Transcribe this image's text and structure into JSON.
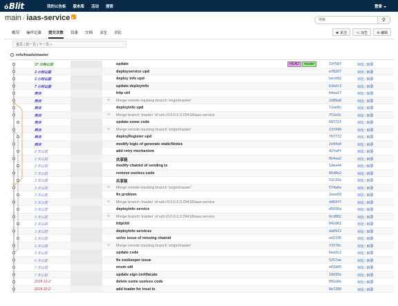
{
  "header": {
    "brand": "Blit",
    "brand_prefix": "ó",
    "nav": [
      "我的公告板",
      "版本库",
      "活动",
      "搜索"
    ],
    "active_nav": 1,
    "login": "登录"
  },
  "repo": {
    "owner": "main",
    "separator": " / ",
    "name": "iaas-service",
    "rss_icon": "rss-icon"
  },
  "search": {
    "placeholder": "搜索",
    "icon": "search-icon"
  },
  "subnav": {
    "items": [
      "概况",
      "操作记录",
      "提交次数",
      "目录",
      "文档",
      "派生",
      "对比"
    ],
    "active": 2
  },
  "actions": {
    "watch": "★ 关注",
    "fork": "⌥ 派生",
    "edit": "⚙ 编辑"
  },
  "pager": "首页 | 前一页 | 下一页 »",
  "ref": "refs/heads/master",
  "badges": {
    "head": "HEAD",
    "master": "master"
  },
  "link_compare": "对比",
  "link_tree": "目录",
  "link_sep": "|",
  "colors": {
    "topbar": "#0a2a4a",
    "merge": "#48a845",
    "link": "#2a5fa8",
    "head_badge": "#f19bf4",
    "master_badge": "#9ef58a"
  },
  "commits": [
    {
      "date": "37 分钟以前",
      "msg": "update",
      "hash": "19f587",
      "merge": false,
      "dc": "c-green",
      "bold": true
    },
    {
      "date": "3 小时以前",
      "msg": "deployservice upd",
      "hash": "ef8267",
      "merge": false,
      "dc": "c-blue",
      "bold": true
    },
    {
      "date": "3 小时以前",
      "msg": "deploy info upd",
      "hash": "becb02",
      "merge": false,
      "dc": "c-blue",
      "bold": true
    },
    {
      "date": "7 小时以前",
      "msg": "update deployinfo",
      "hash": "b1bdc3",
      "merge": false,
      "dc": "c-blue",
      "bold": true
    },
    {
      "date": "昨天",
      "msg": "http util",
      "hash": "b4aa17",
      "merge": false,
      "dc": "c-blue",
      "bold": true
    },
    {
      "date": "昨天",
      "msg": "Merge remote-tracking branch 'origin/master'",
      "hash": "2d89a8",
      "merge": true,
      "dc": "c-blue",
      "bold": true
    },
    {
      "date": "昨天",
      "msg": "deployinfo upd",
      "hash": "f2ae9c",
      "merge": false,
      "dc": "c-blue",
      "bold": true
    },
    {
      "date": "昨天",
      "msg": "Merge branch 'master' of ssh://10.0.0.3:29418/iaas-service",
      "hash": "f51e3c",
      "merge": true,
      "dc": "c-blue",
      "bold": true
    },
    {
      "date": "昨天",
      "msg": "update some code",
      "hash": "68372f",
      "merge": false,
      "dc": "c-blue",
      "bold": true
    },
    {
      "date": "昨天",
      "msg": "Merge remote-tracking branch 'origin/master'",
      "hash": "23f499",
      "merge": true,
      "dc": "c-blue",
      "bold": true
    },
    {
      "date": "昨天",
      "msg": "deployRegister upd",
      "hash": "f6f772",
      "merge": false,
      "dc": "c-blue",
      "bold": true
    },
    {
      "date": "昨天",
      "msg": "modify logic of generate staticNodes",
      "hash": "2e94a4",
      "merge": false,
      "dc": "c-blue",
      "bold": true
    },
    {
      "date": "2 天以前",
      "msg": "add retry mechanism",
      "hash": "42fa0f",
      "merge": false,
      "dc": "c-lblue",
      "bold": false
    },
    {
      "date": "2 天以前",
      "msg": "共享链",
      "hash": "0b4aa2",
      "merge": false,
      "dc": "c-lblue",
      "bold": false
    },
    {
      "date": "2 天以前",
      "msg": "modify chainid of sending tx",
      "hash": "1dea44",
      "merge": false,
      "dc": "c-lblue",
      "bold": false
    },
    {
      "date": "3 天以前",
      "msg": "remove useless code",
      "hash": "66d8e2",
      "merge": false,
      "dc": "c-lblue",
      "bold": false
    },
    {
      "date": "3 天以前",
      "msg": "共享链",
      "hash": "52c32e",
      "merge": false,
      "dc": "c-lblue",
      "bold": false
    },
    {
      "date": "3 天以前",
      "msg": "Merge remote-tracking branch 'origin/master'",
      "hash": "574a6e",
      "merge": true,
      "dc": "c-lblue",
      "bold": false
    },
    {
      "date": "3 天以前",
      "msg": "fix problem",
      "hash": "2eee03",
      "merge": false,
      "dc": "c-lblue",
      "bold": false
    },
    {
      "date": "3 天以前",
      "msg": "Merge branch 'master' of ssh://10.0.0.3:29418/iaas-service",
      "hash": "d464ff",
      "merge": true,
      "dc": "c-lblue",
      "bold": false
    },
    {
      "date": "3 天以前",
      "msg": "deployinfo service",
      "hash": "d5030a",
      "merge": false,
      "dc": "c-lblue",
      "bold": false
    },
    {
      "date": "3 天以前",
      "msg": "Merge branch 'master' of ssh://10.0.0.3:29418/iaas-service",
      "hash": "0cd082",
      "merge": true,
      "dc": "c-lblue",
      "bold": false
    },
    {
      "date": "3 天以前",
      "msg": "httpUtil",
      "hash": "042d61",
      "merge": false,
      "dc": "c-lblue",
      "bold": false
    },
    {
      "date": "3 天以前",
      "msg": "deployinfo services",
      "hash": "da0913",
      "merge": false,
      "dc": "c-lblue",
      "bold": false
    },
    {
      "date": "3 天以前",
      "msg": "solve issue of missing chainid",
      "hash": "ed1195",
      "merge": false,
      "dc": "c-lblue",
      "bold": false
    },
    {
      "date": "3 天以前",
      "msg": "Merge remote-tracking branch 'origin/master'",
      "hash": "f3f70c",
      "merge": true,
      "dc": "c-lblue",
      "bold": false
    },
    {
      "date": "3 天以前",
      "msg": "update code",
      "hash": "bea3c2",
      "merge": false,
      "dc": "c-lblue",
      "bold": false
    },
    {
      "date": "6 天以前",
      "msg": "fix zookeeper issue",
      "hash": "5257ae",
      "merge": false,
      "dc": "c-lblue",
      "bold": false
    },
    {
      "date": "7 天以前",
      "msg": "enum util",
      "hash": "e63dd5",
      "merge": false,
      "dc": "c-lblue",
      "bold": false
    },
    {
      "date": "7 天以前",
      "msg": "update sign certifacate",
      "hash": "18d35e",
      "merge": false,
      "dc": "c-lblue",
      "bold": false
    },
    {
      "date": "2018-12-2:",
      "msg": "delete some useless code",
      "hash": "891e6e",
      "merge": false,
      "dc": "c-red",
      "bold": false
    },
    {
      "date": "2018-12-2:",
      "msg": "add tcadm for trust tx",
      "hash": "8e7260",
      "merge": false,
      "dc": "c-red",
      "bold": false
    }
  ]
}
